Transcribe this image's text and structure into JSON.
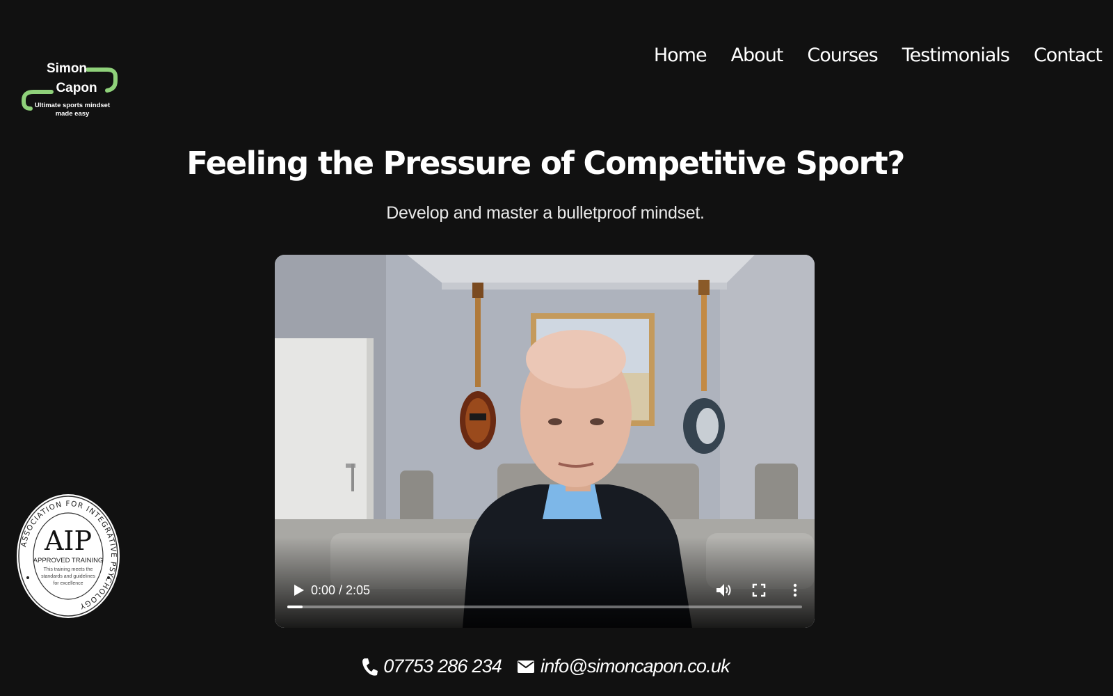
{
  "brand": {
    "name_line1": "Simon",
    "name_line2": "Capon",
    "tagline_line1": "Ultimate sports mindset",
    "tagline_line2": "made easy",
    "accent_color": "#8fd17a"
  },
  "nav": {
    "items": [
      {
        "label": "Home"
      },
      {
        "label": "About"
      },
      {
        "label": "Courses"
      },
      {
        "label": "Testimonials"
      },
      {
        "label": "Contact"
      }
    ]
  },
  "hero": {
    "title": "Feeling the Pressure of Competitive Sport?",
    "subtitle": "Develop and master a bulletproof mindset."
  },
  "video": {
    "time_display": "0:00 / 2:05",
    "progress": 0.03,
    "play_icon": "play-icon",
    "volume_icon": "volume-icon",
    "fullscreen_icon": "fullscreen-icon",
    "more_icon": "more-vertical-icon"
  },
  "badge": {
    "ring_text": "ASSOCIATION FOR INTEGRATIVE PSYCHOLOGY",
    "abbr": "AIP",
    "label": "APPROVED TRAINING",
    "desc_line1": "This training meets the",
    "desc_line2": "standards and guidelines",
    "desc_line3": "for excellence"
  },
  "contact": {
    "phone": "07753 286 234",
    "email": "info@simoncapon.co.uk",
    "phone_icon": "phone-icon",
    "email_icon": "envelope-icon"
  }
}
